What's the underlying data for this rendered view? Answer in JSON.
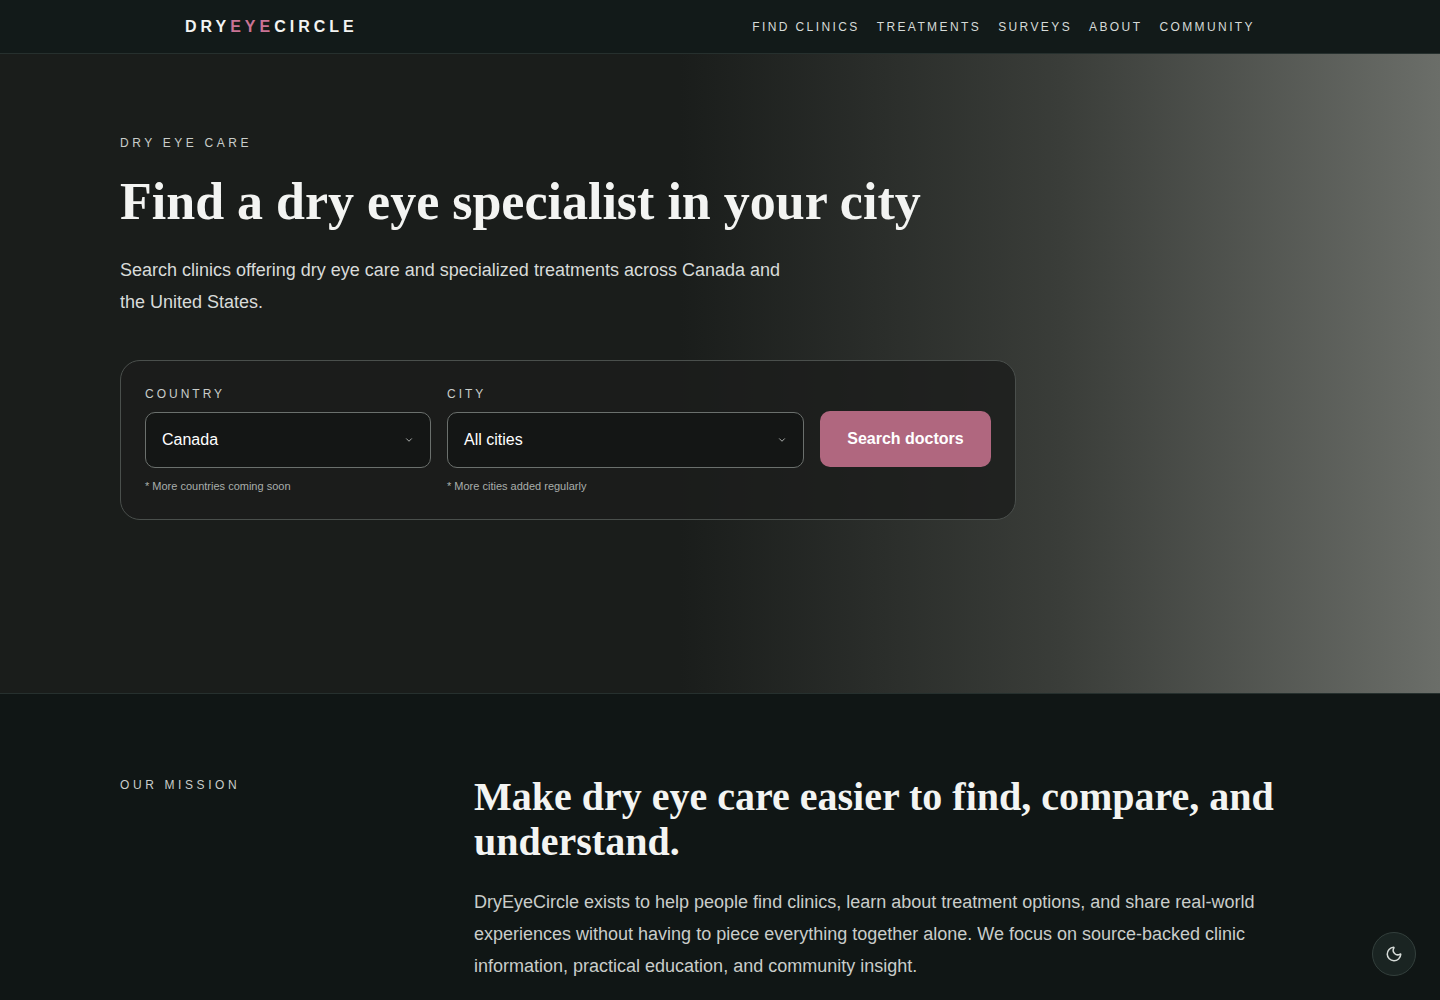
{
  "header": {
    "logo": [
      {
        "text": "DRY",
        "color": "#f3f4f2"
      },
      {
        "text": "EYE",
        "color": "#c97394"
      },
      {
        "text": "CIRCLE",
        "color": "#f3f4f2"
      }
    ],
    "nav": [
      "FIND CLINICS",
      "TREATMENTS",
      "SURVEYS",
      "ABOUT",
      "COMMUNITY"
    ]
  },
  "hero": {
    "eyebrow": "DRY EYE CARE",
    "title": "Find a dry eye specialist in your city",
    "description": "Search clinics offering dry eye care and specialized treatments across Canada and the United States.",
    "search": {
      "fields": [
        {
          "label": "COUNTRY",
          "value": "Canada",
          "note": "* More countries coming soon"
        },
        {
          "label": "CITY",
          "value": "All cities",
          "note": "* More cities added regularly"
        }
      ],
      "button": "Search doctors"
    }
  },
  "mission": {
    "label": "OUR MISSION",
    "title": "Make dry eye care easier to find, compare, and understand.",
    "text": "DryEyeCircle exists to help people find clinics, learn about treatment options, and share real-world experiences without having to piece everything together alone. We focus on source-backed clinic information, practical education, and community insight."
  }
}
